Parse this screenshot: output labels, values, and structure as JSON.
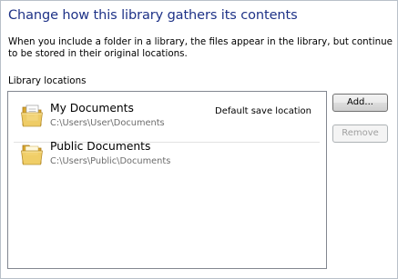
{
  "window": {
    "title": "Change how this library gathers its contents",
    "description": "When you include a folder in a library, the files appear in the library, but continue to be stored in their original locations."
  },
  "library_locations": {
    "label": "Library locations",
    "items": [
      {
        "name": "My Documents",
        "path": "C:\\Users\\User\\Documents",
        "badge": "Default save location",
        "icon": "folder-documents-icon"
      },
      {
        "name": "Public Documents",
        "path": "C:\\Users\\Public\\Documents",
        "icon": "folder-icon"
      }
    ]
  },
  "buttons": {
    "add": "Add...",
    "remove": "Remove"
  },
  "colors": {
    "title": "#1e3287",
    "path_text": "#6d6d6d",
    "disabled_text": "#a0a0a0"
  }
}
